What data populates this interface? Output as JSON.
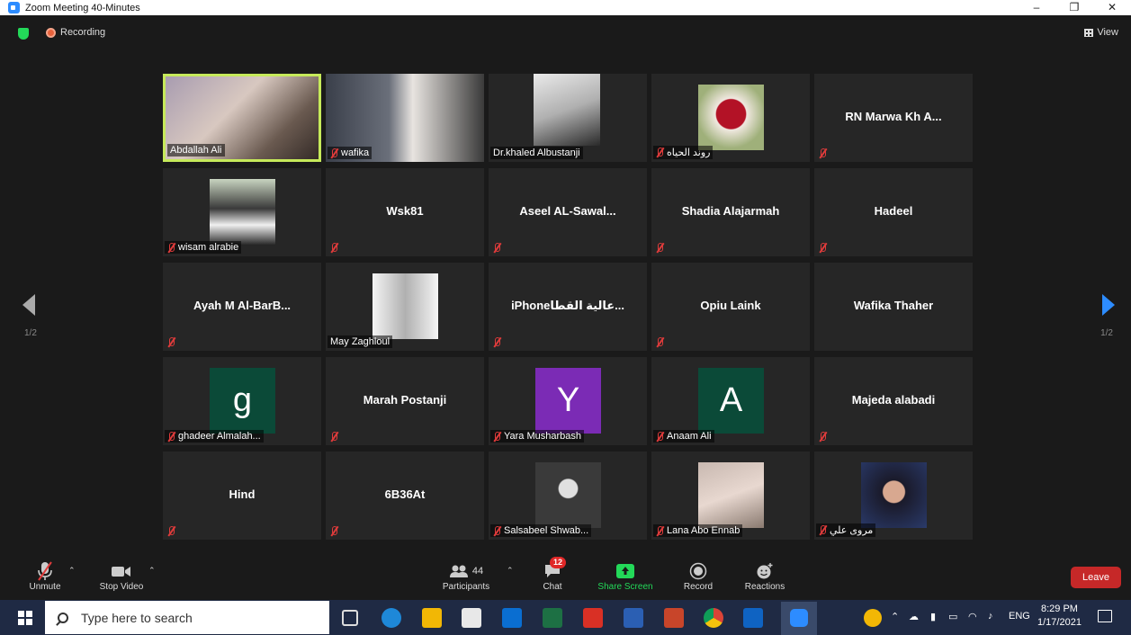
{
  "window": {
    "title": "Zoom Meeting 40-Minutes",
    "min": "–",
    "restore": "❐",
    "close": "✕"
  },
  "meeting": {
    "recording_label": "Recording",
    "view_label": "View",
    "page_left": "1/2",
    "page_right": "1/2"
  },
  "participants": [
    {
      "name": "Abdallah Ali",
      "big": "",
      "muted": false,
      "active": true
    },
    {
      "name": "wafika",
      "big": "",
      "muted": true
    },
    {
      "name": "Dr.khaled Albustanji",
      "big": "",
      "muted": false
    },
    {
      "name": "روند الحياه",
      "big": "",
      "muted": true
    },
    {
      "name": "",
      "big": "RN Marwa Kh A...",
      "muted": true
    },
    {
      "name": "wisam alrabie",
      "big": "",
      "muted": true
    },
    {
      "name": "",
      "big": "Wsk81",
      "muted": true
    },
    {
      "name": "",
      "big": "Aseel AL-Sawal...",
      "muted": true
    },
    {
      "name": "",
      "big": "Shadia Alajarmah",
      "muted": true
    },
    {
      "name": "",
      "big": "Hadeel",
      "muted": true
    },
    {
      "name": "",
      "big": "Ayah M Al-BarB...",
      "muted": true
    },
    {
      "name": "May Zaghloul",
      "big": "",
      "muted": false
    },
    {
      "name": "",
      "big": "iPhoneعالية القطا...",
      "muted": true
    },
    {
      "name": "",
      "big": "Opiu Laink",
      "muted": true
    },
    {
      "name": "",
      "big": "Wafika Thaher",
      "muted": false
    },
    {
      "name": "ghadeer Almalah...",
      "big": "",
      "muted": true,
      "letter": "g",
      "letter_color": "#0b4a38"
    },
    {
      "name": "",
      "big": "Marah Postanji",
      "muted": true
    },
    {
      "name": "Yara Musharbash",
      "big": "",
      "muted": true,
      "letter": "Y",
      "letter_color": "#7b2bb5"
    },
    {
      "name": "Anaam Ali",
      "big": "",
      "muted": true,
      "letter": "A",
      "letter_color": "#0b4a38"
    },
    {
      "name": "",
      "big": "Majeda alabadi",
      "muted": true
    },
    {
      "name": "",
      "big": "Hind",
      "muted": true
    },
    {
      "name": "",
      "big": "6B36At",
      "muted": true
    },
    {
      "name": "Salsabeel Shwab...",
      "big": "",
      "muted": true
    },
    {
      "name": "Lana Abo Ennab",
      "big": "",
      "muted": true
    },
    {
      "name": "مروى علي",
      "big": "",
      "muted": true
    }
  ],
  "toolbar": {
    "unmute": "Unmute",
    "stop_video": "Stop Video",
    "participants": "Participants",
    "participants_count": "44",
    "chat": "Chat",
    "chat_badge": "12",
    "share_screen": "Share Screen",
    "record": "Record",
    "reactions": "Reactions",
    "leave": "Leave"
  },
  "taskbar": {
    "search_placeholder": "Type here to search",
    "lang": "ENG",
    "time": "8:29 PM",
    "date": "1/17/2021"
  },
  "colors": {
    "share_green": "#23d959",
    "leave_red": "#c62828",
    "active_border": "#c6ea5a",
    "zoom_blue": "#2d8cff"
  }
}
